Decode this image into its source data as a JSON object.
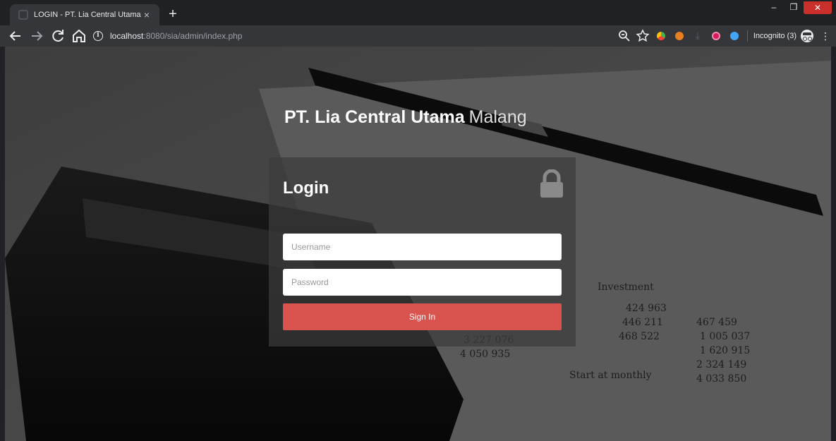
{
  "browser": {
    "tab_title": "LOGIN - PT. Lia Central Utama",
    "tab_close": "×",
    "new_tab": "+",
    "url_host": "localhost",
    "url_path": ":8080/sia/admin/index.php",
    "incognito_label": "Incognito (3)",
    "window_min": "–",
    "window_max": "❐",
    "window_close": "✕"
  },
  "page": {
    "brand_strong": "PT. Lia Central Utama",
    "brand_light": "Malang",
    "login_title": "Login",
    "username_placeholder": "Username",
    "password_placeholder": "Password",
    "signin_label": "Sign In"
  },
  "colors": {
    "accent_button": "#d9534f",
    "chrome_dark": "#202124",
    "toolbar": "#35363a"
  },
  "icons": [
    "back-icon",
    "forward-icon",
    "reload-icon",
    "home-icon",
    "info-icon",
    "zoom-icon",
    "star-icon",
    "lock-icon",
    "incognito-icon",
    "menu-icon"
  ]
}
